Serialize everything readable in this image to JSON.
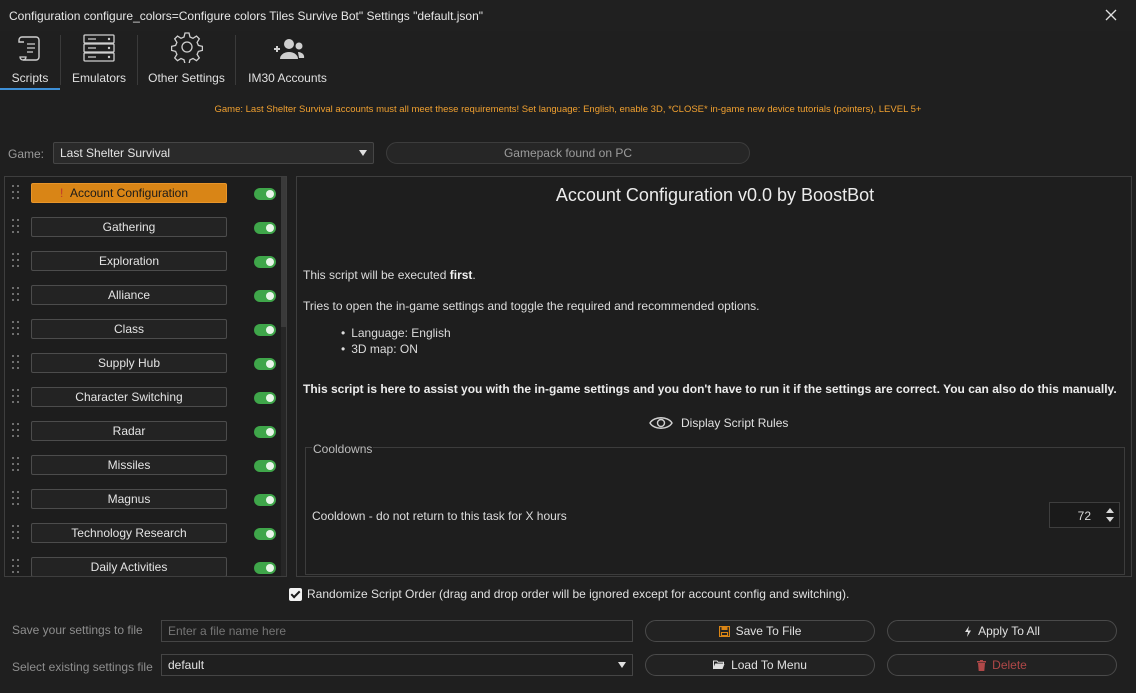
{
  "window": {
    "title": "Configuration configure_colors=Configure colors Tiles Survive Bot\" Settings \"default.json\""
  },
  "toolbar": {
    "items": [
      {
        "label": "Scripts",
        "icon": "scroll-icon"
      },
      {
        "label": "Emulators",
        "icon": "server-icon"
      },
      {
        "label": "Other Settings",
        "icon": "gear-icon"
      },
      {
        "label": "IM30 Accounts",
        "icon": "users-icon"
      }
    ]
  },
  "notice": "Game: Last Shelter Survival accounts must all meet these requirements! Set language: English, enable 3D, *CLOSE* in-game new device tutorials (pointers), LEVEL 5+",
  "game": {
    "label": "Game:",
    "selected": "Last Shelter Survival",
    "gamepack_status": "Gamepack found on PC"
  },
  "scripts": [
    {
      "label": "Account Configuration",
      "active": true,
      "enabled": true
    },
    {
      "label": "Gathering",
      "active": false,
      "enabled": true
    },
    {
      "label": "Exploration",
      "active": false,
      "enabled": true
    },
    {
      "label": "Alliance",
      "active": false,
      "enabled": true
    },
    {
      "label": "Class",
      "active": false,
      "enabled": true
    },
    {
      "label": "Supply Hub",
      "active": false,
      "enabled": true
    },
    {
      "label": "Character Switching",
      "active": false,
      "enabled": true
    },
    {
      "label": "Radar",
      "active": false,
      "enabled": true
    },
    {
      "label": "Missiles",
      "active": false,
      "enabled": true
    },
    {
      "label": "Magnus",
      "active": false,
      "enabled": true
    },
    {
      "label": "Technology Research",
      "active": false,
      "enabled": true
    },
    {
      "label": "Daily Activities",
      "active": false,
      "enabled": true
    }
  ],
  "detail": {
    "title": "Account Configuration v0.0 by BoostBot",
    "p1_prefix": "This script will be executed ",
    "p1_bold": "first",
    "p1_suffix": ".",
    "p2": "Tries to open the in-game settings and toggle the required and recommended options.",
    "bullets": [
      "Language: English",
      "3D map: ON"
    ],
    "p3": "This script is here to assist you with the in-game settings and you don't have to run it if the settings are correct. You can also do this manually.",
    "rules_label": "Display Script Rules",
    "cooldowns_title": "Cooldowns",
    "cooldown_label": "Cooldown - do not return to this task for X hours",
    "cooldown_value": "72"
  },
  "randomize": {
    "checked": true,
    "label": "Randomize Script Order (drag and drop order will be ignored except for account config and switching)."
  },
  "save": {
    "label": "Save your settings to file",
    "placeholder": "Enter a file name here",
    "save_button": "Save To File",
    "apply_button": "Apply To All"
  },
  "load": {
    "label": "Select existing settings file",
    "selected": "default",
    "load_button": "Load To Menu",
    "delete_button": "Delete"
  },
  "colors": {
    "accent": "#d98516",
    "toggle_on": "#3fa64a",
    "notice": "#f0a030",
    "tab_active": "#3d8fd6",
    "danger": "#b04848"
  }
}
